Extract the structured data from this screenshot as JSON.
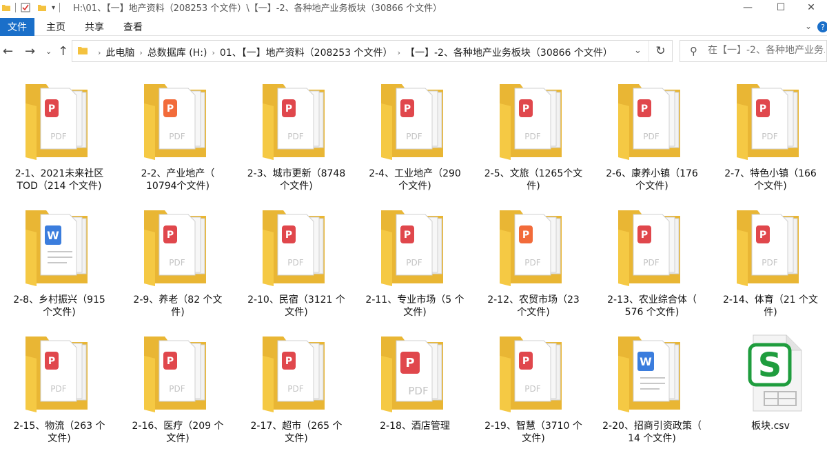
{
  "window": {
    "title": "H:\\01、【一】地产资料（208253 个文件）\\【一】-2、各种地产业务板块（30866 个文件）",
    "controls": {
      "minimize": "—",
      "maximize": "☐",
      "close": "✕"
    }
  },
  "ribbon": {
    "tabs": [
      "文件",
      "主页",
      "共享",
      "查看"
    ]
  },
  "address": {
    "crumbs": [
      "此电脑",
      "总数据库 (H:)",
      "01、【一】地产资料（208253 个文件）",
      "【一】-2、各种地产业务板块（30866 个文件）"
    ]
  },
  "search": {
    "placeholder": "在【一】-2、各种地产业务..."
  },
  "items": [
    {
      "line1": "2-1、2021未来社区",
      "line2": "TOD（214 个文件)",
      "icon": "folder-pdf",
      "accent": "#e0474c"
    },
    {
      "line1": "2-2、产业地产（",
      "line2": "10794个文件)",
      "icon": "folder-pdf",
      "accent": "#f26b3a"
    },
    {
      "line1": "2-3、城市更新（8748",
      "line2": "个文件)",
      "icon": "folder-pdf",
      "accent": "#e0474c"
    },
    {
      "line1": "2-4、工业地产（290",
      "line2": "个文件)",
      "icon": "folder-pdf",
      "accent": "#e0474c"
    },
    {
      "line1": "2-5、文旅（1265个文",
      "line2": "件)",
      "icon": "folder-pdf",
      "accent": "#e0474c"
    },
    {
      "line1": "2-6、康养小镇（176",
      "line2": "个文件)",
      "icon": "folder-pdf",
      "accent": "#e0474c"
    },
    {
      "line1": "2-7、特色小镇（166",
      "line2": "个文件)",
      "icon": "folder-pdf",
      "accent": "#e0474c"
    },
    {
      "line1": "2-8、乡村振兴（915",
      "line2": "个文件)",
      "icon": "folder-word",
      "accent": "#3b7ddd"
    },
    {
      "line1": "2-9、养老（82 个文",
      "line2": "件)",
      "icon": "folder-pdf",
      "accent": "#e0474c"
    },
    {
      "line1": "2-10、民宿（3121 个",
      "line2": "文件)",
      "icon": "folder-pdf",
      "accent": "#e0474c"
    },
    {
      "line1": "2-11、专业市场（5 个",
      "line2": "文件)",
      "icon": "folder-pdf",
      "accent": "#e0474c"
    },
    {
      "line1": "2-12、农贸市场（23",
      "line2": "个文件)",
      "icon": "folder-pdf",
      "accent": "#f26b3a"
    },
    {
      "line1": "2-13、农业综合体（",
      "line2": "576 个文件)",
      "icon": "folder-pdf",
      "accent": "#e0474c"
    },
    {
      "line1": "2-14、体育（21 个文",
      "line2": "件)",
      "icon": "folder-pdf",
      "accent": "#e0474c"
    },
    {
      "line1": "2-15、物流（263 个",
      "line2": "文件)",
      "icon": "folder-pdf",
      "accent": "#e0474c"
    },
    {
      "line1": "2-16、医疗（209 个",
      "line2": "文件)",
      "icon": "folder-pdf",
      "accent": "#e0474c"
    },
    {
      "line1": "2-17、超市（265 个",
      "line2": "文件)",
      "icon": "folder-pdf",
      "accent": "#e0474c"
    },
    {
      "line1": "2-18、酒店管理",
      "line2": "",
      "icon": "folder-pdf-big",
      "accent": "#e0474c"
    },
    {
      "line1": "2-19、智慧（3710 个",
      "line2": "文件)",
      "icon": "folder-pdf",
      "accent": "#e0474c"
    },
    {
      "line1": "2-20、招商引资政策（",
      "line2": "14 个文件)",
      "icon": "folder-word",
      "accent": "#3b7ddd"
    },
    {
      "line1": "板块.csv",
      "line2": "",
      "icon": "csv-file",
      "accent": "#1f9d3e"
    }
  ]
}
